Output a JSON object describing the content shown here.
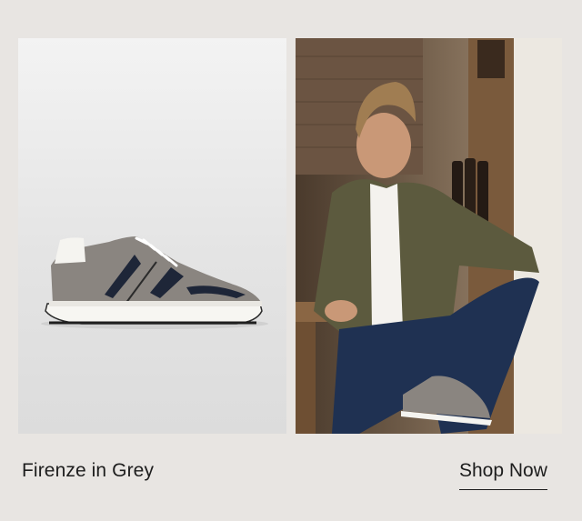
{
  "product": {
    "caption": "Firenze in Grey"
  },
  "cta": {
    "label": "Shop Now"
  },
  "images": {
    "product_shot": "grey-suede-sneaker-image",
    "lifestyle_shot": "man-wearing-sneakers-in-wine-bar-image"
  },
  "colors": {
    "background": "#e8e5e2",
    "text": "#1d1d1d",
    "shoe_suede": "#8a8580",
    "shoe_accent": "#1e2638"
  }
}
